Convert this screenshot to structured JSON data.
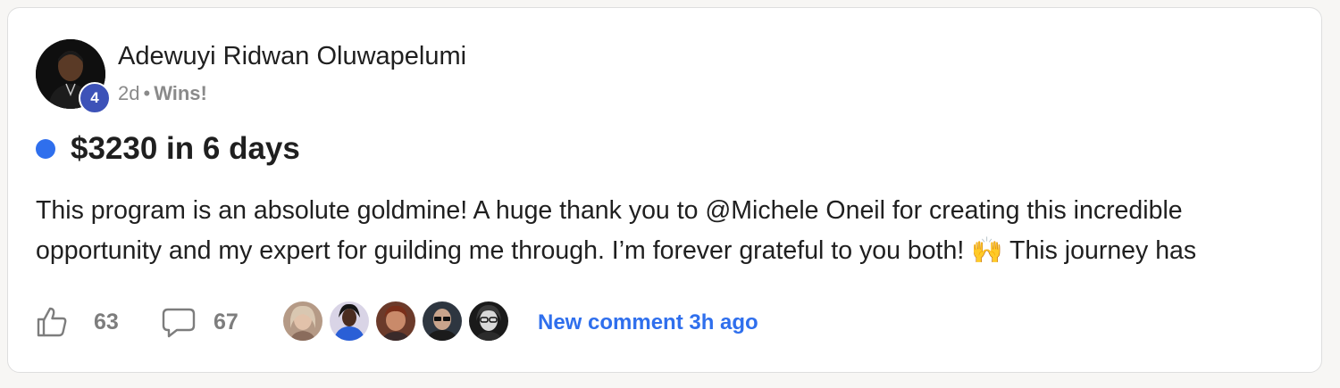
{
  "post": {
    "author": {
      "name": "Adewuyi Ridwan Oluwapelumi",
      "level": "4"
    },
    "meta": {
      "time": "2d",
      "separator": "•",
      "category": "Wins!"
    },
    "title": "$3230 in 6 days",
    "body": "This program is an absolute goldmine! A huge thank you to @Michele Oneil for creating this incredible opportunity and my expert for guilding me through. I’m forever grateful to you both! 🙌 This journey has",
    "footer": {
      "likes": "63",
      "comments": "67",
      "new_comment": "New comment 3h ago"
    }
  },
  "colors": {
    "accent": "#2f6fed",
    "level_badge": "#3d52b8",
    "muted": "#7d7d7d"
  },
  "icons": {
    "like": "thumbs-up-icon",
    "comment": "speech-bubble-icon"
  }
}
